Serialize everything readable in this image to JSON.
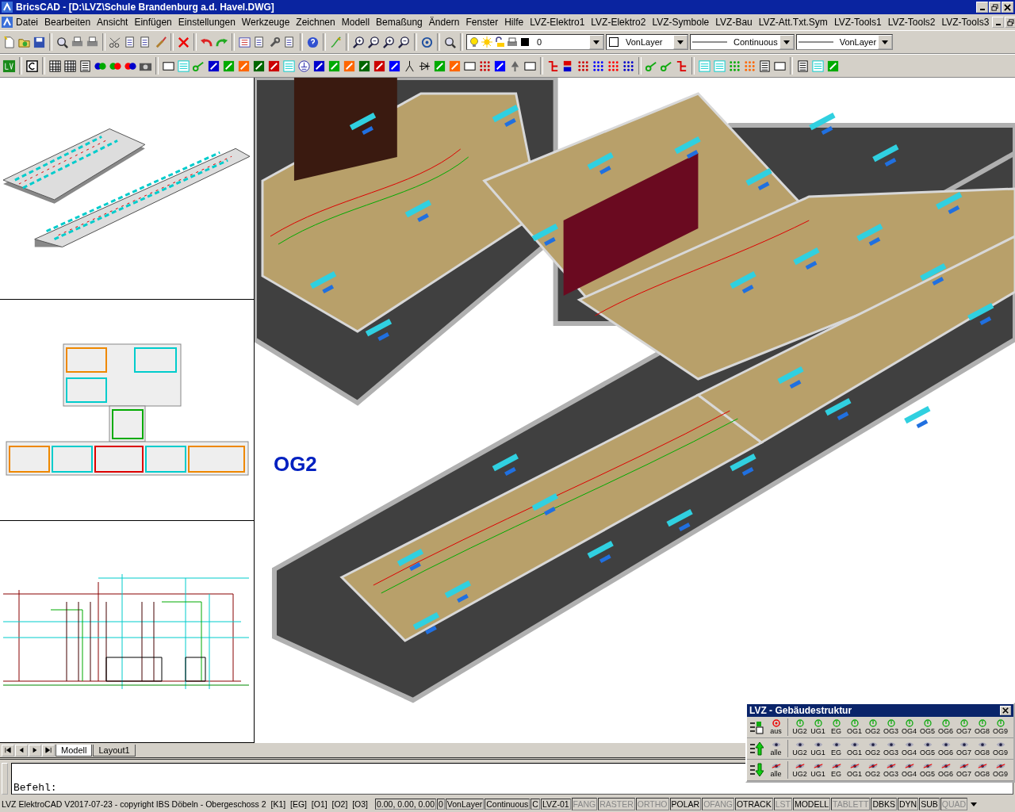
{
  "window": {
    "title": "BricsCAD - [D:\\LVZ\\Schule Brandenburg a.d. Havel.DWG]"
  },
  "menu": [
    "Datei",
    "Bearbeiten",
    "Ansicht",
    "Einfügen",
    "Einstellungen",
    "Werkzeuge",
    "Zeichnen",
    "Modell",
    "Bemaßung",
    "Ändern",
    "Fenster",
    "Hilfe",
    "LVZ-Elektro1",
    "LVZ-Elektro2",
    "LVZ-Symbole",
    "LVZ-Bau",
    "LVZ-Att.Txt.Sym",
    "LVZ-Tools1",
    "LVZ-Tools2",
    "LVZ-Tools3"
  ],
  "properties": {
    "layer": "0",
    "color_mode": "VonLayer",
    "linetype": "Continuous",
    "lineweight": "VonLayer"
  },
  "viewport": {
    "label": "OG2"
  },
  "layout_tabs": [
    {
      "label": "Modell",
      "selected": true
    },
    {
      "label": "Layout1",
      "selected": false
    }
  ],
  "command_line": {
    "prompt": "Befehl:"
  },
  "status_bar": {
    "text": "LVZ ElektroCAD V2017-07-23 - copyright IBS Döbeln - Obergeschoss 2  [K1]  [EG]  [O1]  [O2]  [O3]",
    "fields": [
      "0.00, 0.00, 0.00",
      "0",
      "VonLayer",
      "Continuous",
      "C",
      "LVZ-01"
    ],
    "toggles": [
      {
        "label": "FANG",
        "on": false
      },
      {
        "label": "RASTER",
        "on": false
      },
      {
        "label": "ORTHO",
        "on": false
      },
      {
        "label": "POLAR",
        "on": true
      },
      {
        "label": "OFANG",
        "on": false
      },
      {
        "label": "OTRACK",
        "on": true
      },
      {
        "label": "LST",
        "on": false
      },
      {
        "label": "MODELL",
        "on": true
      },
      {
        "label": "TABLETT",
        "on": false
      },
      {
        "label": "DBKS",
        "on": true
      },
      {
        "label": "DYN",
        "on": true
      },
      {
        "label": "SUB",
        "on": true
      },
      {
        "label": "QUAD",
        "on": false
      }
    ]
  },
  "panel": {
    "title": "LVZ - Gebäudestruktur",
    "rows": [
      {
        "kind": "switch",
        "all_label": "aus",
        "floors": [
          "UG2",
          "UG1",
          "EG",
          "OG1",
          "OG2",
          "OG3",
          "OG4",
          "OG5",
          "OG6",
          "OG7",
          "OG8",
          "OG9"
        ]
      },
      {
        "kind": "show",
        "all_label": "alle",
        "floors": [
          "UG2",
          "UG1",
          "EG",
          "OG1",
          "OG2",
          "OG3",
          "OG4",
          "OG5",
          "OG6",
          "OG7",
          "OG8",
          "OG9"
        ]
      },
      {
        "kind": "hide",
        "all_label": "alle",
        "floors": [
          "UG2",
          "UG1",
          "EG",
          "OG1",
          "OG2",
          "OG3",
          "OG4",
          "OG5",
          "OG6",
          "OG7",
          "OG8",
          "OG9"
        ]
      }
    ]
  }
}
